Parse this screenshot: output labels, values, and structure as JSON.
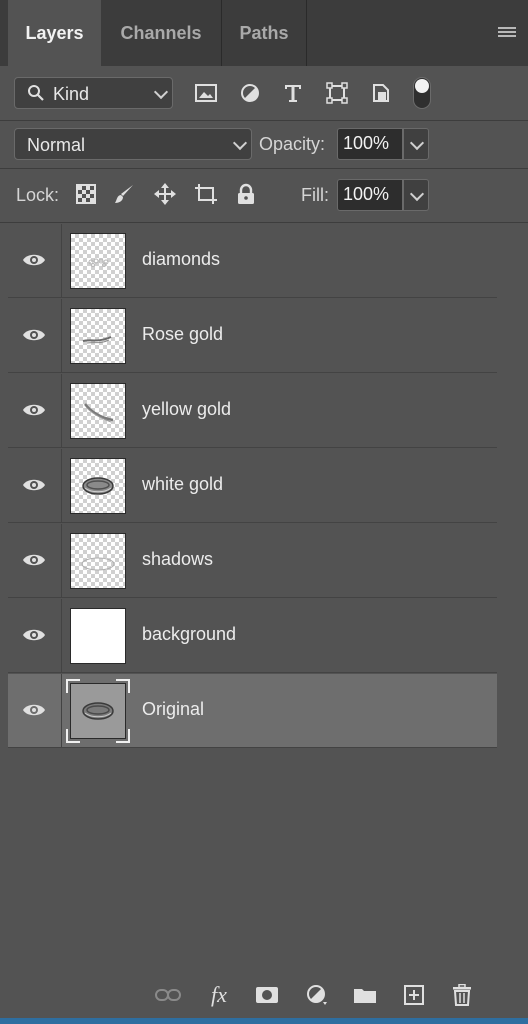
{
  "tabs": [
    {
      "label": "Layers",
      "active": true
    },
    {
      "label": "Channels",
      "active": false
    },
    {
      "label": "Paths",
      "active": false
    }
  ],
  "filter": {
    "kind_label": "Kind",
    "icons": [
      "image-filter-icon",
      "adjustment-filter-icon",
      "type-filter-icon",
      "shape-filter-icon",
      "smart-object-filter-icon"
    ],
    "toggle_on": true
  },
  "blend": {
    "mode": "Normal",
    "opacity_label": "Opacity:",
    "opacity_value": "100%"
  },
  "lock": {
    "label": "Lock:",
    "fill_label": "Fill:",
    "fill_value": "100%",
    "icons": [
      "lock-transparent-pixels-icon",
      "lock-image-pixels-icon",
      "lock-position-icon",
      "lock-artboard-icon",
      "lock-all-icon"
    ]
  },
  "layers": [
    {
      "name": "diamonds",
      "visible": true,
      "thumb": "transparent",
      "selected": false
    },
    {
      "name": "Rose gold",
      "visible": true,
      "thumb": "transparent",
      "selected": false
    },
    {
      "name": "yellow gold",
      "visible": true,
      "thumb": "transparent",
      "selected": false
    },
    {
      "name": "white gold",
      "visible": true,
      "thumb": "transparent",
      "selected": false
    },
    {
      "name": "shadows",
      "visible": true,
      "thumb": "transparent",
      "selected": false
    },
    {
      "name": "background",
      "visible": true,
      "thumb": "white",
      "selected": false
    },
    {
      "name": "Original",
      "visible": true,
      "thumb": "photo",
      "selected": true
    }
  ],
  "bottom_icons": [
    "link-layers-icon",
    "fx-icon",
    "layer-mask-icon",
    "adjustment-layer-icon",
    "group-folder-icon",
    "new-layer-icon",
    "trash-icon"
  ],
  "bottom_fx_label": "fx",
  "colors": {
    "panel": "#535353",
    "tabbar": "#3c3c3c",
    "selected_row": "#6e6e6e",
    "accent_strip": "#2e6ea0"
  }
}
